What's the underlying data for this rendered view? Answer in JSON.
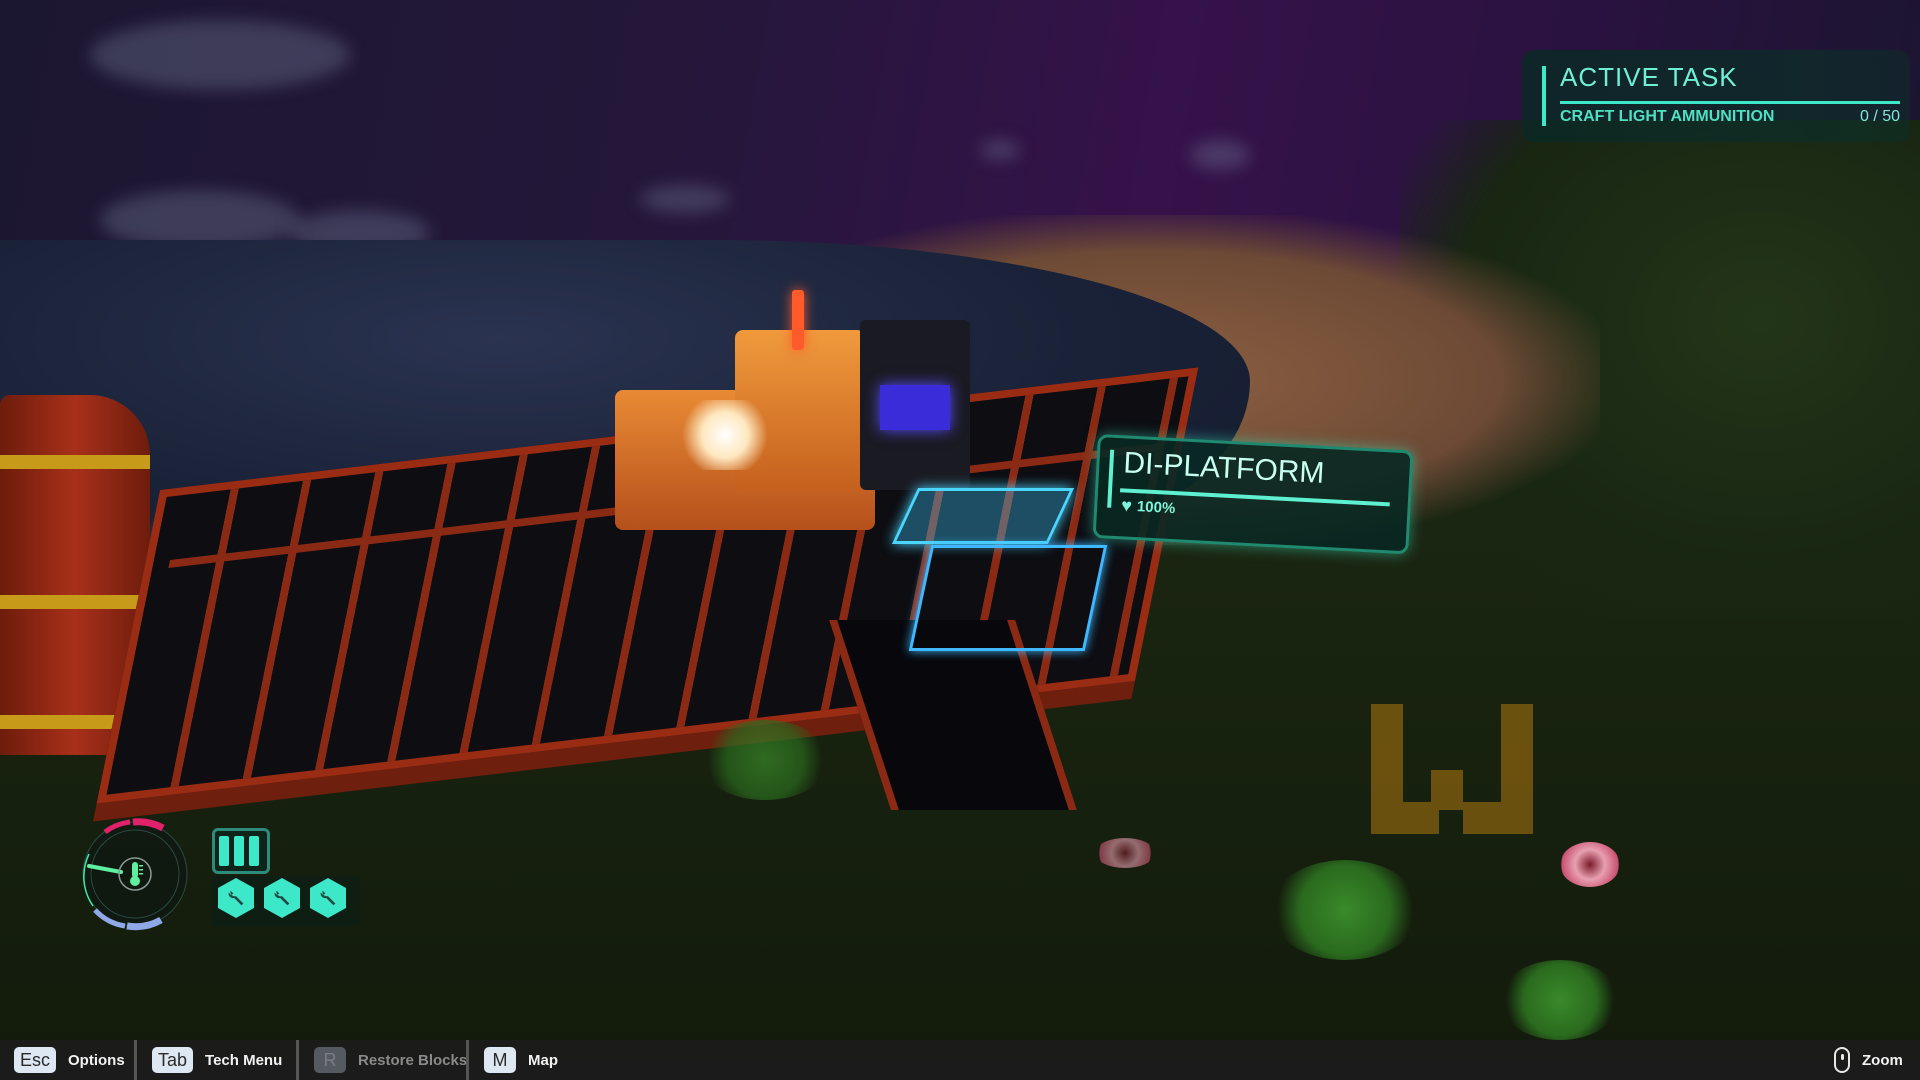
{
  "active_task": {
    "heading": "ACTIVE TASK",
    "task_name": "CRAFT LIGHT AMMUNITION",
    "progress_text": "0 / 50",
    "progress_current": 0,
    "progress_total": 50
  },
  "target": {
    "name": "DI-PLATFORM",
    "health_icon": "heart-icon",
    "health_text": "100%",
    "health_fraction": 1.0
  },
  "status": {
    "temperature_icon": "thermometer-icon",
    "battery_icon": "battery-charging-icon",
    "battery_cells_full": 3,
    "repair_kits": [
      {
        "icon": "wrench-icon"
      },
      {
        "icon": "wrench-icon"
      },
      {
        "icon": "wrench-icon"
      }
    ]
  },
  "controls": [
    {
      "key": "Esc",
      "label": "Options",
      "enabled": true
    },
    {
      "key": "Tab",
      "label": "Tech Menu",
      "enabled": true
    },
    {
      "key": "R",
      "label": "Restore Blocks",
      "enabled": false
    },
    {
      "key": "M",
      "label": "Map",
      "enabled": true
    }
  ],
  "zoom_control": {
    "icon": "mouse-scroll-icon",
    "label": "Zoom"
  },
  "colors": {
    "hud_accent": "#3de8c8",
    "heat_color": "#e0226a",
    "cold_color": "#8fa8e8",
    "platform_red": "#9a2c14",
    "sky_purple": "#35124a"
  }
}
